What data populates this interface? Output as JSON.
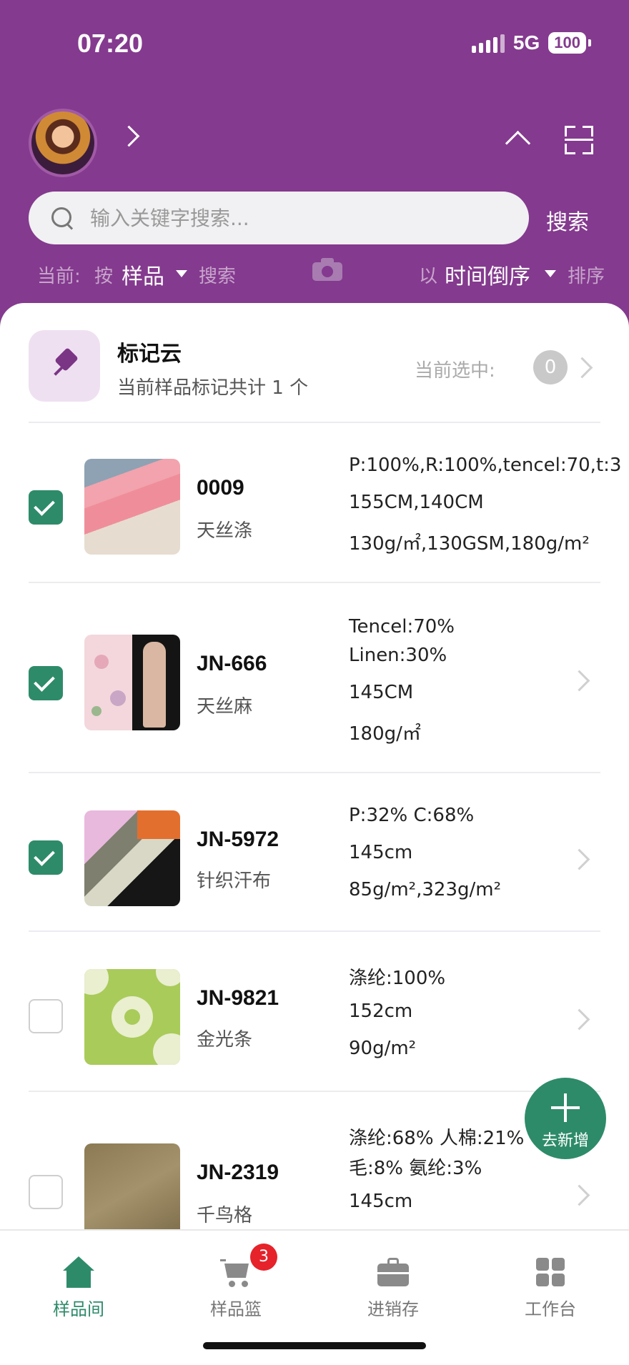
{
  "status_bar": {
    "time": "07:20",
    "network": "5G",
    "battery": "100"
  },
  "search": {
    "placeholder": "输入关键字搜索...",
    "value": "",
    "button_label": "搜索"
  },
  "filter": {
    "current_label": "当前:",
    "by_label": "按",
    "field_value": "样品",
    "search_suffix": "搜索",
    "order_prefix": "以",
    "order_value": "时间倒序",
    "order_suffix": "排序"
  },
  "mark_cloud": {
    "title": "标记云",
    "subtitle": "当前样品标记共计 1 个",
    "selected_label": "当前选中:",
    "selected_count": "0"
  },
  "samples": [
    {
      "checked": true,
      "code": "0009",
      "name": "天丝涤",
      "specs": [
        "P:100%,R:100%,tencel:70,t:3",
        "155CM,140CM",
        "130g/㎡,130GSM,180g/m²"
      ]
    },
    {
      "checked": true,
      "code": "JN-666",
      "name": "天丝麻",
      "specs": [
        "Tencel:70%",
        "Linen:30%",
        "145CM",
        "180g/㎡"
      ]
    },
    {
      "checked": true,
      "code": "JN-5972",
      "name": "针织汗布",
      "specs": [
        "P:32% C:68%",
        "145cm",
        "85g/m²,323g/m²"
      ]
    },
    {
      "checked": false,
      "code": "JN-9821",
      "name": "金光条",
      "specs": [
        "涤纶:100%",
        "152cm",
        "90g/m²"
      ]
    },
    {
      "checked": false,
      "code": "JN-2319",
      "name": "千鸟格",
      "specs": [
        "涤纶:68% 人棉:21% ·",
        "毛:8% 氨纶:3%",
        "145cm"
      ]
    }
  ],
  "fab": {
    "label": "去新增"
  },
  "tabs": [
    {
      "label": "样品间",
      "icon": "home-icon",
      "active": true
    },
    {
      "label": "样品篮",
      "icon": "cart-icon",
      "badge": "3"
    },
    {
      "label": "进销存",
      "icon": "briefcase-icon"
    },
    {
      "label": "工作台",
      "icon": "grid-icon"
    }
  ],
  "colors": {
    "brand": "#843a8e",
    "accent": "#2e8b6a",
    "badge": "#e6222a"
  }
}
